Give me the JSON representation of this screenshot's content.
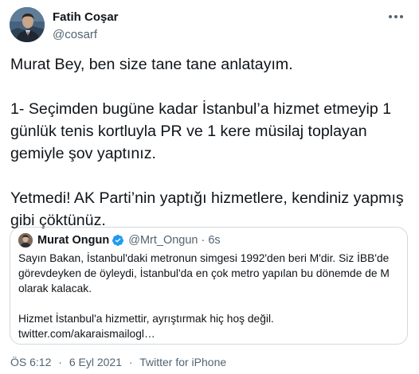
{
  "author": {
    "name": "Fatih Coşar",
    "handle": "@cosarf"
  },
  "tweet": {
    "paragraphs": [
      "Murat Bey, ben size tane tane anlatayım.",
      "1- Seçimden bugüne kadar İstanbul’a hizmet etmeyip 1 günlük tenis kortluyla PR ve 1 kere müsilaj toplayan gemiyle şov yaptınız.",
      "Yetmedi! AK Parti’nin yaptığı hizmetlere, kendiniz yapmış gibi çöktünüz."
    ]
  },
  "quoted": {
    "name": "Murat Ongun",
    "handle": "@Mrt_Ongun",
    "separator": "·",
    "time": "6s",
    "paragraph_1": "Sayın Bakan, İstanbul'daki metronun simgesi 1992'den beri M'dir. Siz İBB'de görevdeyken de öyleydi, İstanbul'da en çok metro yapılan bu dönemde de M olarak kalacak.",
    "paragraph_2": "Hizmet İstanbul'a hizmettir, ayrıştırmak hiç hoş değil.",
    "link": "twitter.com/akaraismailogl…"
  },
  "meta": {
    "time": "ÖS 6:12",
    "separator_1": "·",
    "date": "6 Eyl 2021",
    "separator_2": "·",
    "source": "Twitter for iPhone"
  },
  "colors": {
    "text": "#0f1419",
    "secondary": "#536471",
    "border": "#cfd9de",
    "verified": "#1d9bf0"
  },
  "icons": {
    "more": "more-dots-icon",
    "verified": "verified-badge-icon"
  }
}
